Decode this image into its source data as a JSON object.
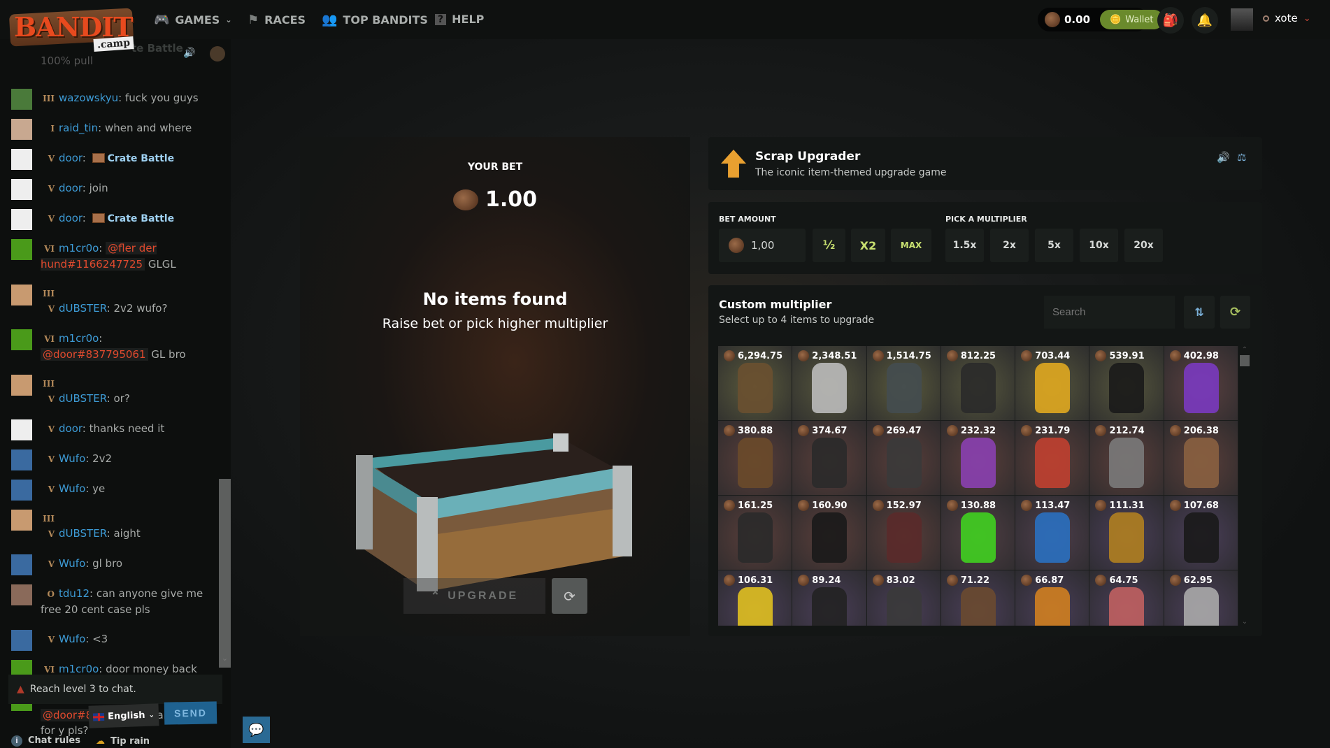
{
  "header": {
    "logo": "BANDIT .camp",
    "nav": [
      {
        "label": "GAMES",
        "icon": "gamepad-icon",
        "dropdown": true
      },
      {
        "label": "RACES",
        "icon": "flag-icon"
      },
      {
        "label": "TOP BANDITS",
        "icon": "users-icon"
      },
      {
        "label": "HELP",
        "icon": "help-icon"
      }
    ],
    "balance": "0.00",
    "wallet_label": "Wallet",
    "username": "xote",
    "accent": "#6a8a2c"
  },
  "chat": {
    "partial_top": {
      "text_line1": "te Battle",
      "text_line2": "100% pull"
    },
    "messages": [
      {
        "rank": "III",
        "user": "wazowskyu",
        "text": "fuck you guys",
        "av": "#4a7a3a"
      },
      {
        "rank": "I",
        "user": "raid_tin",
        "text": "when and where",
        "av": "#c8a890"
      },
      {
        "rank": "V",
        "user": "door",
        "crate": "Crate Battle",
        "av": "#eeeeee"
      },
      {
        "rank": "V",
        "user": "door",
        "text": "join",
        "av": "#eeeeee"
      },
      {
        "rank": "V",
        "user": "door",
        "crate": "Crate Battle",
        "av": "#eeeeee"
      },
      {
        "rank": "VI",
        "user": "m1cr0o",
        "mention": "@fler der hund#1166247725",
        "text": "GLGL",
        "av": "#4a9a1a"
      },
      {
        "rank": "III V",
        "user": "dUBSTER",
        "text": "2v2 wufo?",
        "av": "#c89a70"
      },
      {
        "rank": "VI",
        "user": "m1cr0o",
        "mention": "@door#837795061",
        "text": "GL bro",
        "av": "#4a9a1a"
      },
      {
        "rank": "III V",
        "user": "dUBSTER",
        "text": "or?",
        "av": "#c89a70"
      },
      {
        "rank": "V",
        "user": "door",
        "text": "thanks need it",
        "av": "#eeeeee"
      },
      {
        "rank": "V",
        "user": "Wufo",
        "text": "2v2",
        "av": "#3a6aa0"
      },
      {
        "rank": "V",
        "user": "Wufo",
        "text": "ye",
        "av": "#3a6aa0"
      },
      {
        "rank": "III V",
        "user": "dUBSTER",
        "text": "aight",
        "av": "#c89a70"
      },
      {
        "rank": "V",
        "user": "Wufo",
        "text": "gl bro",
        "av": "#3a6aa0"
      },
      {
        "rank": "O",
        "user": "tdu12",
        "text": "can anyone give me free 20 cent case pls",
        "av": "#8a6a5a"
      },
      {
        "rank": "V",
        "user": "Wufo",
        "text": "<3",
        "av": "#3a6aa0"
      },
      {
        "rank": "VI",
        "user": "m1cr0o",
        "text": "door money back",
        "av": "#4a9a1a"
      },
      {
        "rank": "VI",
        "user": "m1cr0o",
        "mention": "@door#837795061",
        "text": "can i call for y pls?",
        "av": "#4a9a1a"
      }
    ],
    "notice": "Reach level 3 to chat.",
    "language": "English",
    "send_label": "SEND",
    "footer": {
      "rules": "Chat rules",
      "tip": "Tip rain"
    }
  },
  "game": {
    "your_bet_label": "YOUR BET",
    "your_bet_value": "1.00",
    "empty_title": "No items found",
    "empty_sub": "Raise bet or pick higher multiplier",
    "upgrade_label": "UPGRADE",
    "title": "Scrap Upgrader",
    "subtitle": "The iconic item-themed upgrade game",
    "bet_amount_label": "BET AMOUNT",
    "bet_amount_value": "1,00",
    "bet_buttons": [
      "½",
      "X2",
      "MAX"
    ],
    "multiplier_label": "PICK A MULTIPLIER",
    "multipliers": [
      "1.5x",
      "2x",
      "5x",
      "10x",
      "20x"
    ],
    "custom_title": "Custom multiplier",
    "custom_sub": "Select up to 4 items to upgrade",
    "search_placeholder": "Search",
    "items": [
      {
        "price": "6,294.75",
        "bg": "#5a5a3c",
        "c": "#6a5030"
      },
      {
        "price": "2,348.51",
        "bg": "#55553c",
        "c": "#bbbbbb"
      },
      {
        "price": "1,514.75",
        "bg": "#5a5a3c",
        "c": "#444c50"
      },
      {
        "price": "812.25",
        "bg": "#55553c",
        "c": "#2a2a2a"
      },
      {
        "price": "703.44",
        "bg": "#55553c",
        "c": "#e0a820"
      },
      {
        "price": "539.91",
        "bg": "#55553c",
        "c": "#1a1a1a"
      },
      {
        "price": "402.98",
        "bg": "#5a4040",
        "c": "#7a3ac0"
      },
      {
        "price": "380.88",
        "bg": "#5a3e3a",
        "c": "#6a4a2a"
      },
      {
        "price": "374.67",
        "bg": "#5a3e3a",
        "c": "#2a2a2a"
      },
      {
        "price": "269.47",
        "bg": "#5a3e3a",
        "c": "#3a3a3a"
      },
      {
        "price": "232.32",
        "bg": "#5a3e3a",
        "c": "#8a40b0"
      },
      {
        "price": "231.79",
        "bg": "#5a3e3a",
        "c": "#c04030"
      },
      {
        "price": "212.74",
        "bg": "#5a3e3a",
        "c": "#7a7a7a"
      },
      {
        "price": "206.38",
        "bg": "#5a3e3a",
        "c": "#8a6040"
      },
      {
        "price": "161.25",
        "bg": "#5a3e3a",
        "c": "#2a2a2a"
      },
      {
        "price": "160.90",
        "bg": "#5a3e3a",
        "c": "#1a1a1a"
      },
      {
        "price": "152.97",
        "bg": "#5a3e3a",
        "c": "#5a2a2a"
      },
      {
        "price": "130.88",
        "bg": "#503e44",
        "c": "#40d020"
      },
      {
        "price": "113.47",
        "bg": "#4e3e4c",
        "c": "#2a70c0"
      },
      {
        "price": "111.31",
        "bg": "#4a3e58",
        "c": "#b08020"
      },
      {
        "price": "107.68",
        "bg": "#4a3e58",
        "c": "#1a1a1a"
      },
      {
        "price": "106.31",
        "bg": "#4a3e58",
        "c": "#e0c020"
      },
      {
        "price": "89.24",
        "bg": "#4a3e58",
        "c": "#222222"
      },
      {
        "price": "83.02",
        "bg": "#4a3e58",
        "c": "#3a3a3a"
      },
      {
        "price": "71.22",
        "bg": "#4a3e58",
        "c": "#6a4a30"
      },
      {
        "price": "66.87",
        "bg": "#4a3e58",
        "c": "#d08020"
      },
      {
        "price": "64.75",
        "bg": "#4a3e58",
        "c": "#c06060"
      },
      {
        "price": "62.95",
        "bg": "#4a3e58",
        "c": "#aaaaaa"
      }
    ]
  }
}
